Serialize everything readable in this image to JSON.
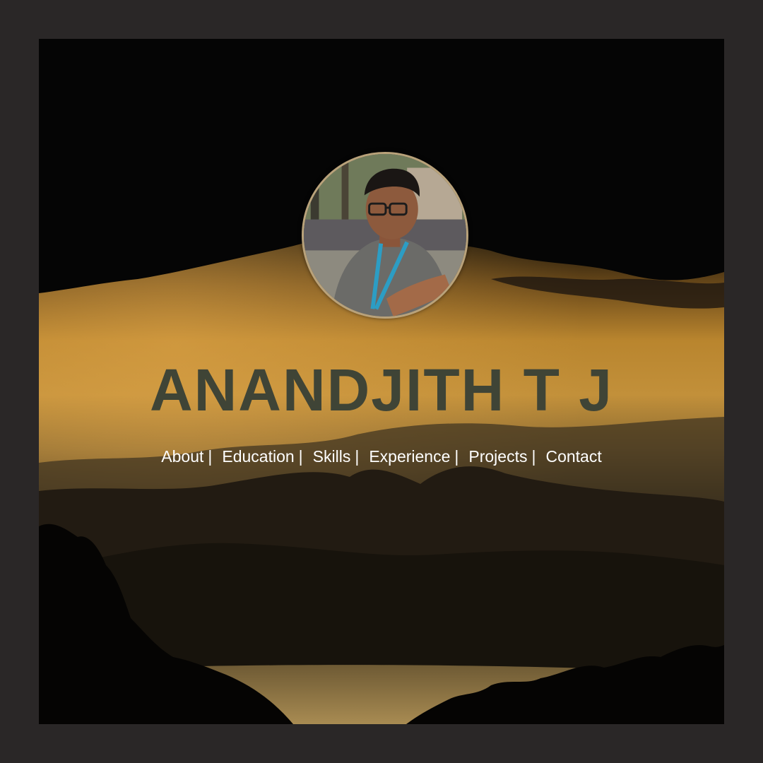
{
  "header": {
    "name": "ANANDJITH T J"
  },
  "nav": {
    "items": [
      {
        "label": "About"
      },
      {
        "label": "Education"
      },
      {
        "label": "Skills"
      },
      {
        "label": "Experience"
      },
      {
        "label": "Projects"
      },
      {
        "label": "Contact"
      }
    ],
    "separator": "|"
  },
  "avatar": {
    "icon": "profile-photo"
  },
  "colors": {
    "page_border": "#2a2727",
    "name_text": "#3f4436",
    "nav_text": "#ffffff",
    "sky_glow": "#c8922e"
  }
}
